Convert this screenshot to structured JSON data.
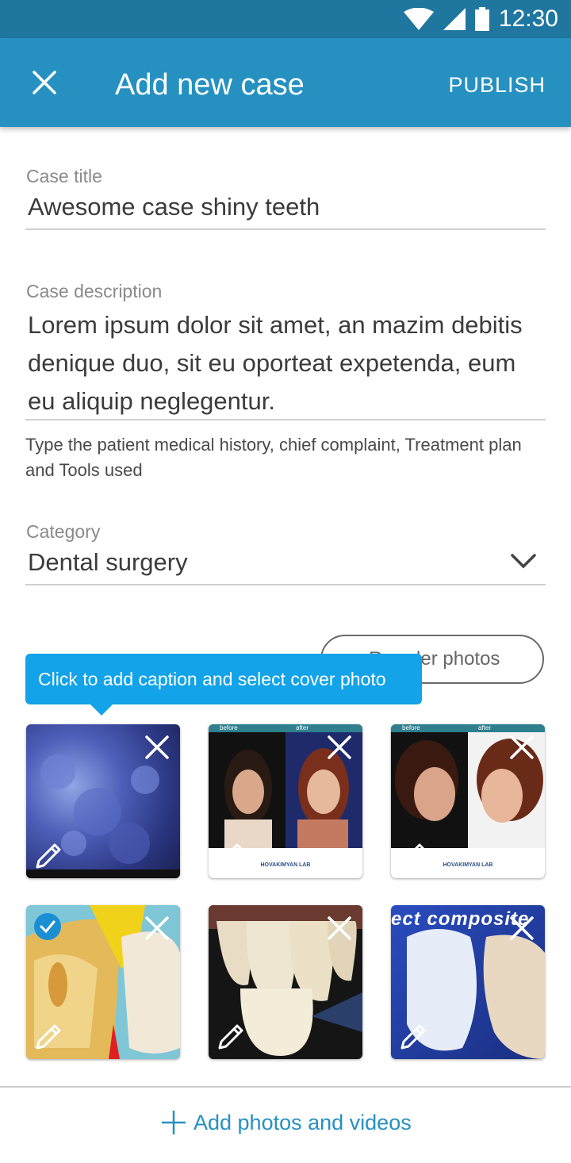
{
  "status_bar": {
    "time": "12:30"
  },
  "app_bar": {
    "title": "Add new case",
    "publish_label": "PUBLISH"
  },
  "case_title": {
    "label": "Case title",
    "value": "Awesome case shiny teeth"
  },
  "case_description": {
    "label": "Case description",
    "value": "Lorem ipsum dolor sit amet, an mazim debitis denique duo, sit eu oporteat expetenda, eum eu aliquip neglegentur.",
    "helper": "Type the patient medical history, chief complaint, Treatment plan and Tools used"
  },
  "category": {
    "label": "Category",
    "value": "Dental surgery"
  },
  "photos_section": {
    "reorder_label": "Reorder photos",
    "tooltip": "Click to add caption and select cover photo",
    "before_label": "before",
    "after_label": "after",
    "lab_logo": "HOVAKIMYAN LAB",
    "composite_overlay": "ect composite"
  },
  "add_photos_label": "Add photos and videos",
  "colors": {
    "status_bar": "#1f77a0",
    "app_bar": "#2691c0",
    "tooltip": "#12a3e8",
    "accent": "#2691c0"
  }
}
